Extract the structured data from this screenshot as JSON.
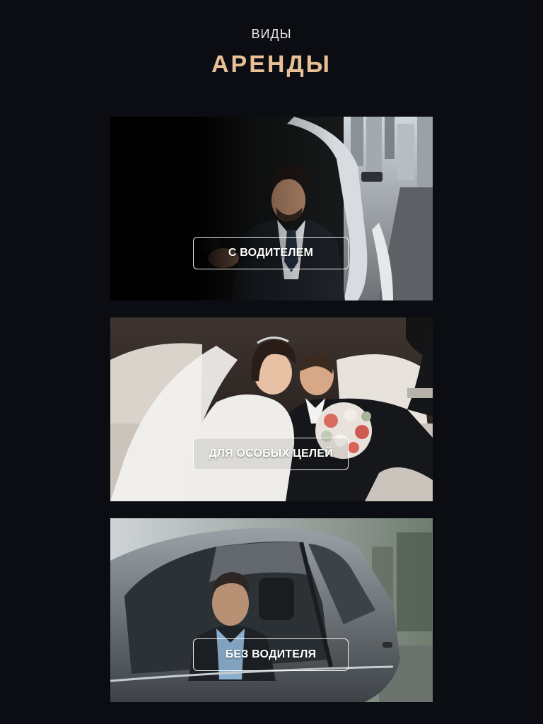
{
  "header": {
    "subtitle": "ВИДЫ",
    "title": "АРЕНДЫ"
  },
  "cards": [
    {
      "label": "С ВОДИТЕЛЕМ"
    },
    {
      "label": "ДЛЯ ОСОБЫХ ЦЕЛЕЙ"
    },
    {
      "label": "БЕЗ ВОДИТЕЛЯ"
    }
  ],
  "colors": {
    "background": "#0b0d13",
    "accent": "#e9bf95",
    "button_border": "#ffffff"
  }
}
